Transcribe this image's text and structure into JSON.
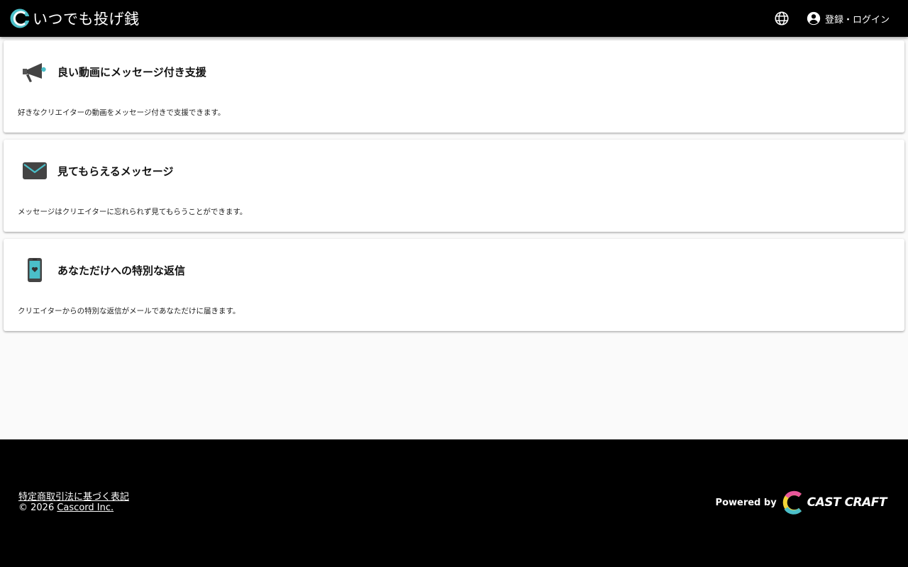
{
  "header": {
    "title": "いつでも投げ銭",
    "login_label": "登録・ログイン",
    "logo_icon": "circle-c-logo-icon",
    "language_icon": "globe-icon",
    "account_icon": "account-circle-icon"
  },
  "features": [
    {
      "icon": "megaphone-icon",
      "title": "良い動画にメッセージ付き支援",
      "description": "好きなクリエイターの動画をメッセージ付きで支援できます。"
    },
    {
      "icon": "envelope-icon",
      "title": "見てもらえるメッセージ",
      "description": "メッセージはクリエイターに忘れられず見てもらうことができます。"
    },
    {
      "icon": "phone-heart-icon",
      "title": "あなただけへの特別な返信",
      "description": "クリエイターからの特別な返信がメールであなただけに届きます。"
    }
  ],
  "footer": {
    "legal_link": "特定商取引法に基づく表記",
    "copyright_prefix": "© 2026 ",
    "company_link": "Cascord Inc.",
    "powered_by": "Powered by",
    "brand": "CAST CRAFT"
  },
  "colors": {
    "appbar": "#000000",
    "accent_teal": "#4bbfc9",
    "icon_dark": "#444444",
    "background": "#fafafa"
  }
}
